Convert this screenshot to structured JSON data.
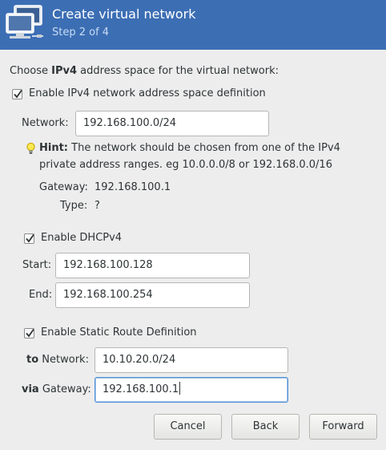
{
  "header": {
    "title": "Create virtual network",
    "step": "Step 2 of 4",
    "icon": "network-computers-icon"
  },
  "intro": {
    "prefix": "Choose ",
    "bold": "IPv4",
    "suffix": " address space for the virtual network:"
  },
  "ipv4": {
    "enable_label": "Enable IPv4 network address space definition",
    "enabled": true,
    "network_label": "Network:",
    "network_value": "192.168.100.0/24",
    "hint_bold": "Hint:",
    "hint_line1": " The network should be chosen from one of the IPv4",
    "hint_line2": "private address ranges. eg 10.0.0.0/8 or 192.168.0.0/16",
    "gateway_label": "Gateway:",
    "gateway_value": "192.168.100.1",
    "type_label": "Type:",
    "type_value": "?"
  },
  "dhcp": {
    "enable_label": "Enable DHCPv4",
    "enabled": true,
    "start_label": "Start:",
    "start_value": "192.168.100.128",
    "end_label": "End:",
    "end_value": "192.168.100.254"
  },
  "static_route": {
    "enable_label": "Enable Static Route Definition",
    "enabled": true,
    "to_bold": "to",
    "to_rest": " Network:",
    "to_value": "10.10.20.0/24",
    "via_bold": "via",
    "via_rest": " Gateway:",
    "via_value": "192.168.100.1"
  },
  "buttons": {
    "cancel": "Cancel",
    "back": "Back",
    "forward": "Forward"
  },
  "colors": {
    "header_bg": "#3c6eb4",
    "window_bg": "#ededed",
    "focus": "#4a90d9"
  }
}
